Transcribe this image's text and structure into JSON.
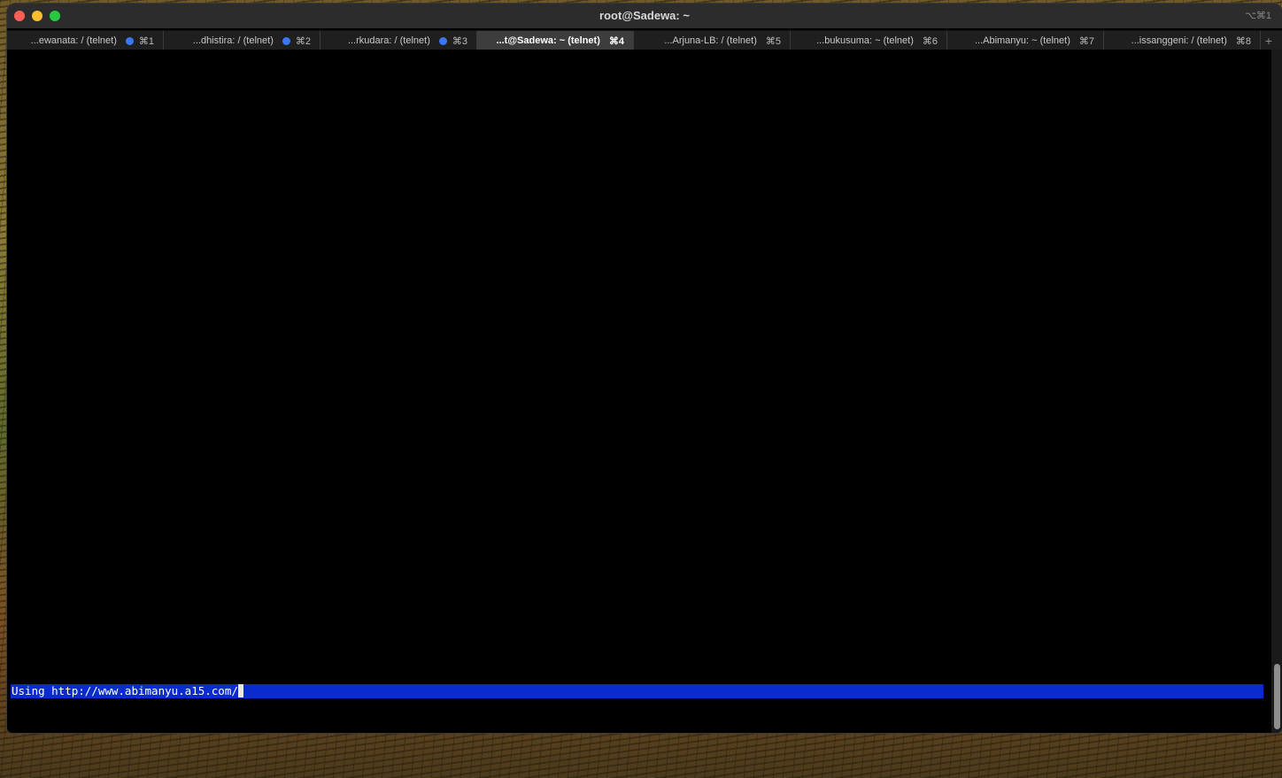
{
  "window": {
    "title": "root@Sadewa: ~",
    "shortcut": "⌥⌘1"
  },
  "tabs": [
    {
      "label": "...ewanata: / (telnet)",
      "key": "⌘1",
      "activity": true,
      "active": false
    },
    {
      "label": "...dhistira: / (telnet)",
      "key": "⌘2",
      "activity": true,
      "active": false
    },
    {
      "label": "...rkudara: / (telnet)",
      "key": "⌘3",
      "activity": true,
      "active": false
    },
    {
      "label": "...t@Sadewa: ~ (telnet)",
      "key": "⌘4",
      "activity": false,
      "active": true
    },
    {
      "label": "...Arjuna-LB: / (telnet)",
      "key": "⌘5",
      "activity": false,
      "active": false
    },
    {
      "label": "...bukusuma: ~ (telnet)",
      "key": "⌘6",
      "activity": false,
      "active": false
    },
    {
      "label": "...Abimanyu: ~ (telnet)",
      "key": "⌘7",
      "activity": false,
      "active": false
    },
    {
      "label": "...issanggeni: / (telnet)",
      "key": "⌘8",
      "activity": false,
      "active": false
    }
  ],
  "new_tab_label": "+",
  "terminal": {
    "status_text": "Using http://www.abimanyu.a15.com/"
  },
  "colors": {
    "status_bg": "#0a2ccf",
    "activity_dot": "#3a78f2"
  }
}
